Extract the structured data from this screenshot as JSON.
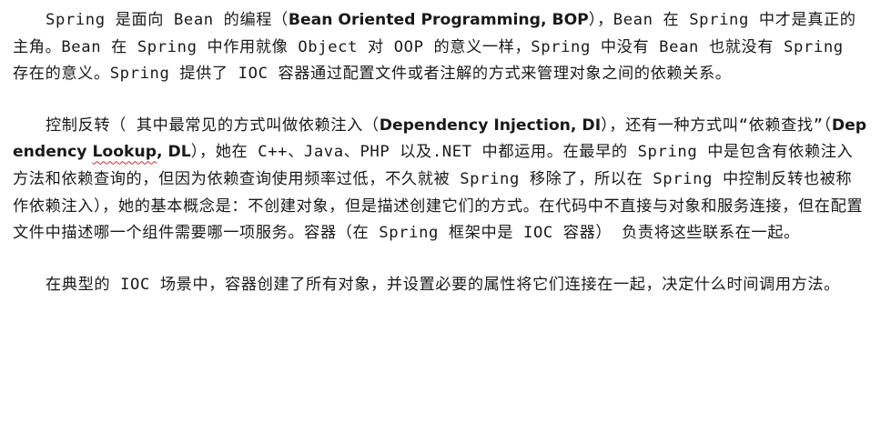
{
  "paragraphs": [
    {
      "segments": [
        {
          "t": "Spring 是面向 Bean 的编程（"
        },
        {
          "t": "Bean Oriented Programming, BOP",
          "bold": true
        },
        {
          "t": "），Bean 在 Spring 中才是真正的主角。Bean 在 Spring 中作用就像 Object 对 OOP 的意义一样，Spring 中没有 Bean 也就没有 Spring 存在的意义。Spring 提供了 IOC 容器通过配置文件或者注解的方式来管理对象之间的依赖关系。"
        }
      ]
    },
    {
      "segments": [
        {
          "t": "控制反转（  其中最常见的方式叫做依赖注入（"
        },
        {
          "t": "Dependency Injection, DI",
          "bold": true
        },
        {
          "t": "），还有一种方式叫“依赖查找”（"
        },
        {
          "t": "Dependency ",
          "bold": true
        },
        {
          "t": "Lookup",
          "bold": true,
          "wavy": true
        },
        {
          "t": ", DL",
          "bold": true
        },
        {
          "t": "），她在 C++、Java、PHP 以及.NET 中都运用。在最早的 Spring 中是包含有依赖注入方法和依赖查询的，但因为依赖查询使用频率过低，不久就被 Spring 移除了，所以在 Spring 中控制反转也被称作依赖注入），她的基本概念是：不创建对象，但是描述创建它们的方式。在代码中不直接与对象和服务连接，但在配置文件中描述哪一个组件需要哪一项服务。容器（在 Spring 框架中是 IOC 容器） 负责将这些联系在一起。"
        }
      ]
    },
    {
      "segments": [
        {
          "t": "在典型的 IOC 场景中，容器创建了所有对象，并设置必要的属性将它们连接在一起，决定什么时间调用方法。"
        }
      ]
    }
  ]
}
